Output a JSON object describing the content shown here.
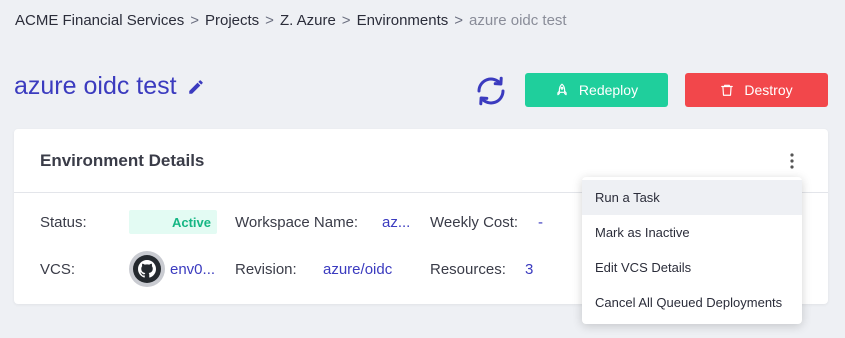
{
  "breadcrumb": {
    "items": [
      "ACME Financial Services",
      "Projects",
      "Z. Azure",
      "Environments",
      "azure oidc test"
    ],
    "separator": ">"
  },
  "page": {
    "title": "azure oidc test"
  },
  "actions": {
    "redeploy_label": "Redeploy",
    "destroy_label": "Destroy"
  },
  "card": {
    "title": "Environment Details",
    "status_label": "Status:",
    "status_value": "Active",
    "workspace_label": "Workspace Name:",
    "workspace_value": "az...",
    "weekly_cost_label": "Weekly Cost:",
    "weekly_cost_value": "-",
    "vcs_label": "VCS:",
    "vcs_value": "env0...",
    "revision_label": "Revision:",
    "revision_value": "azure/oidc",
    "resources_label": "Resources:",
    "resources_value": "3"
  },
  "menu": {
    "items": [
      "Run a Task",
      "Mark as Inactive",
      "Edit VCS Details",
      "Cancel All Queued Deployments"
    ]
  },
  "icons": {
    "edit": "pencil-icon",
    "refresh": "refresh-icon",
    "redeploy": "rocket-icon",
    "destroy": "trash-icon",
    "menu": "kebab-menu-icon",
    "vcs": "github-icon"
  },
  "colors": {
    "accent": "#3b3bbf",
    "redeploy": "#1fcf9c",
    "destroy": "#f2474b",
    "status_active": "#16b684",
    "background": "#eef0f4"
  }
}
